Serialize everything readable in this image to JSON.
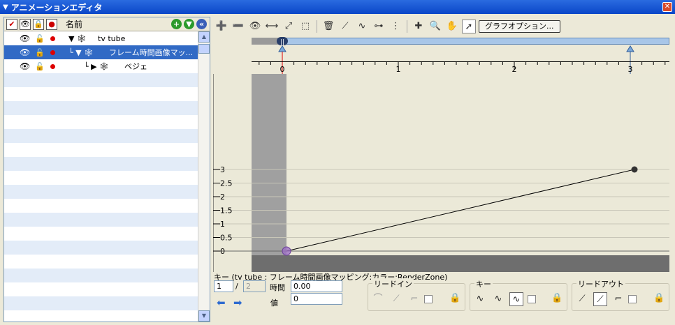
{
  "window": {
    "title": "アニメーションエディタ",
    "title_arrow": "▼",
    "close_glyph": "✕"
  },
  "tree": {
    "header": {
      "check_glyph": "✔",
      "eye_glyph": "👁",
      "lock_glyph": "🔒",
      "rec_glyph": "●",
      "name_label": "名前",
      "add_glyph": "+",
      "down_glyph": "▼",
      "collapse_glyph": "«"
    },
    "rows": [
      {
        "label": "tv tube",
        "prefix": "▼ 🕸",
        "indent": 0,
        "selected": false
      },
      {
        "label": "フレーム時間画像マッ...",
        "prefix": "└ ▼ 🕸",
        "indent": 1,
        "selected": true
      },
      {
        "label": "ベジェ",
        "prefix": "└ ▶ 🕸",
        "indent": 2,
        "selected": false
      }
    ],
    "eye_glyph": "👁",
    "lock_glyph": "🔓",
    "scroll_up": "▲",
    "scroll_down": "▼"
  },
  "toolbar": {
    "icons": [
      {
        "name": "add-key-icon",
        "glyph": "➕"
      },
      {
        "name": "remove-key-icon",
        "glyph": "➖"
      },
      {
        "name": "view-icon",
        "glyph": "👁"
      },
      {
        "name": "fit-horizontal-icon",
        "glyph": "⟷"
      },
      {
        "name": "fit-all-icon",
        "glyph": "⤢"
      },
      {
        "name": "fit-selection-icon",
        "glyph": "⬚"
      },
      {
        "name": "delete-icon",
        "glyph": "🗑"
      },
      {
        "name": "linear-curve-icon",
        "glyph": "⟋"
      },
      {
        "name": "bezier-curve-icon",
        "glyph": "∿"
      },
      {
        "name": "step-curve-icon",
        "glyph": "⊶"
      },
      {
        "name": "vertical-keys-icon",
        "glyph": "⋮"
      },
      {
        "name": "add-point-icon",
        "glyph": "✚"
      },
      {
        "name": "zoom-icon",
        "glyph": "🔍"
      },
      {
        "name": "pan-hand-icon",
        "glyph": "✋"
      },
      {
        "name": "select-pointer-icon",
        "glyph": "➚"
      }
    ],
    "graph_options_label": "グラフオプション..."
  },
  "timeline": {
    "ticks": [
      "0",
      "1",
      "2",
      "3"
    ]
  },
  "chart_data": {
    "type": "line",
    "x": [
      0,
      3
    ],
    "series": [
      {
        "values": [
          0,
          3
        ]
      }
    ],
    "xlim": [
      -0.3,
      3.3
    ],
    "ylim": [
      -0.1,
      3.15
    ],
    "yticks": [
      "3",
      "2.5",
      "2",
      "1.5",
      "1",
      "0.5",
      "0"
    ],
    "grid": true,
    "keyframes": [
      {
        "x": 0,
        "y": 0,
        "color": "#9c6fc4"
      },
      {
        "x": 3,
        "y": 3,
        "color": "#333333"
      }
    ]
  },
  "key_panel": {
    "info": "キー (tv tube : フレーム時間画像マッピング:カラー:RenderZone)",
    "key_index": "1",
    "slash": "/",
    "key_count": "2",
    "time_label": "時間",
    "time_value": "0.00",
    "value_label": "値",
    "value_value": "0",
    "prev_glyph": "⬅",
    "next_glyph": "➡",
    "lead_in_label": "リードイン",
    "key_label": "キー",
    "lead_out_label": "リードアウト",
    "lead_in_icons": [
      "⌒",
      "⟋",
      "⌐"
    ],
    "key_icons": [
      "∿",
      "∿",
      "∿"
    ],
    "lead_out_icons": [
      "⟋",
      "⟋",
      "⌐"
    ],
    "lock_glyph": "🔒"
  }
}
